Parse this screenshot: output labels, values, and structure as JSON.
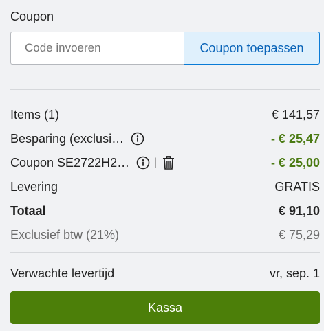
{
  "coupon": {
    "title": "Coupon",
    "input_placeholder": "Code invoeren",
    "apply_label": "Coupon toepassen"
  },
  "summary": {
    "items_label": "Items (1)",
    "items_value": "€ 141,57",
    "savings_label": "Besparing (exclusi…",
    "savings_value": "- € 25,47",
    "coupon_label": "Coupon SE2722H2…",
    "coupon_separator": "|",
    "coupon_value": "- € 25,00",
    "delivery_label": "Levering",
    "delivery_value": "GRATIS",
    "total_label": "Totaal",
    "total_value": "€ 91,10",
    "excl_vat_label": "Exclusief btw (21%)",
    "excl_vat_value": "€ 75,29"
  },
  "delivery_time": {
    "label": "Verwachte levertijd",
    "value": "vr, sep. 1"
  },
  "checkout": {
    "label": "Kassa"
  },
  "colors": {
    "accent_blue": "#0a7bd6",
    "savings_green": "#4a7a12",
    "checkout_green": "#4c7f09",
    "background": "#f1f2f4"
  },
  "icons": [
    "info-icon",
    "trash-icon"
  ]
}
